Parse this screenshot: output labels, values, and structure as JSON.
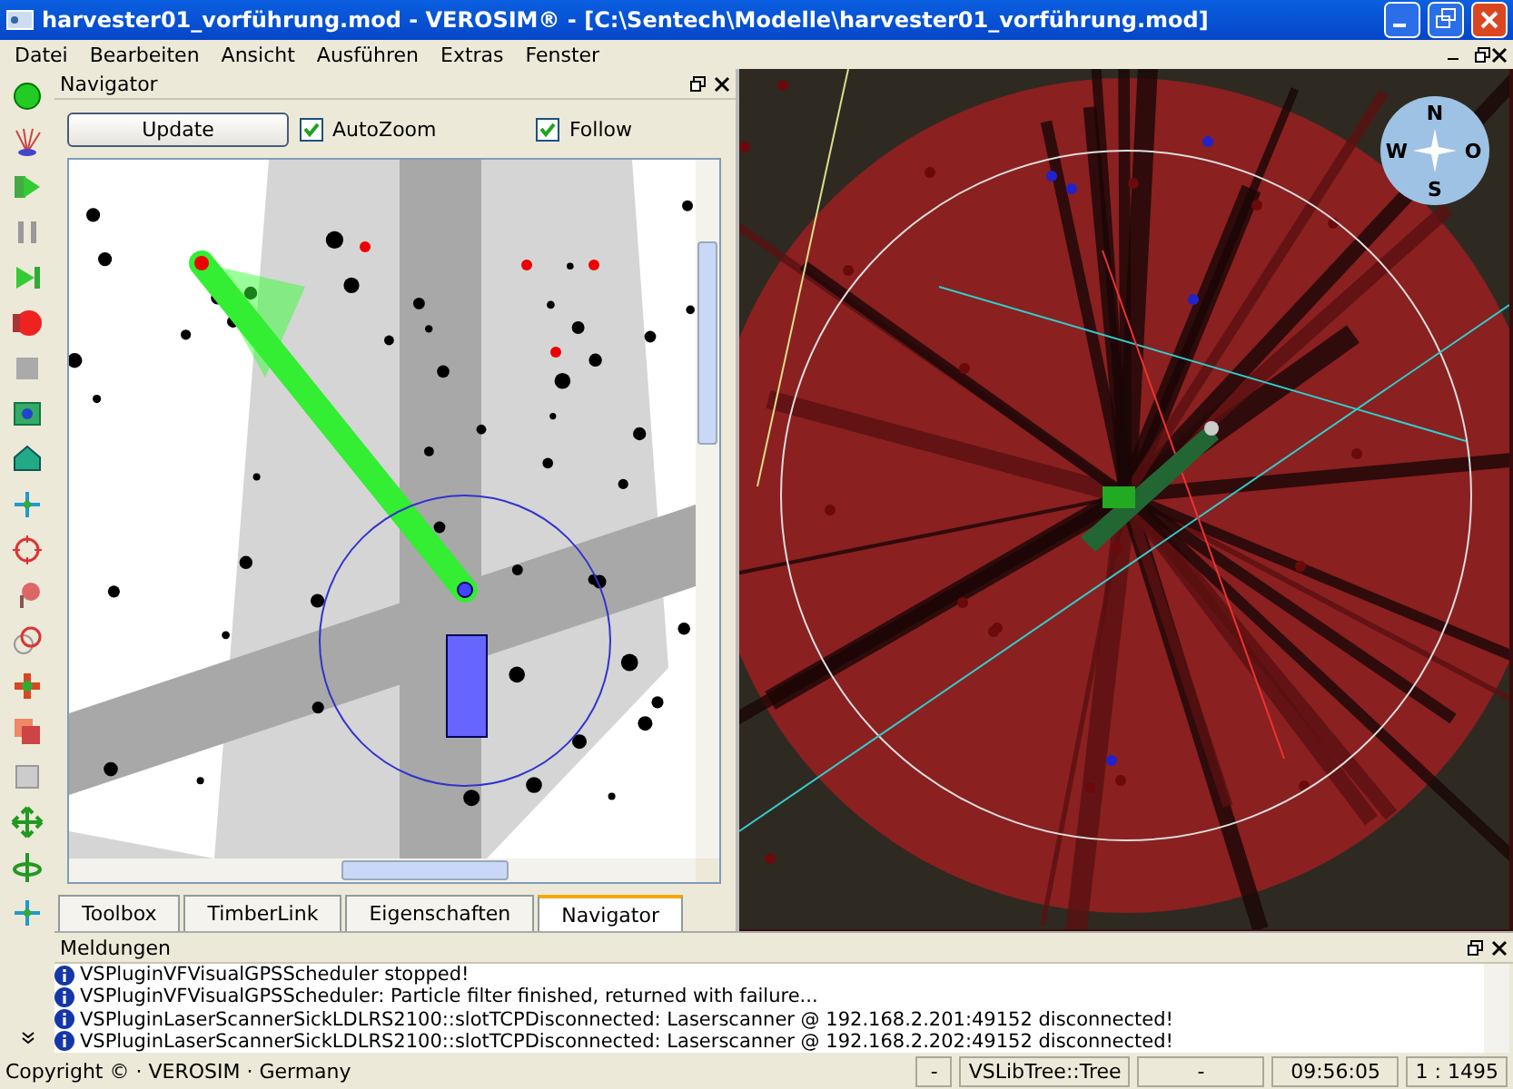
{
  "window": {
    "title": "harvester01_vorführung.mod - VEROSIM® - [C:\\Sentech\\Modelle\\harvester01_vorführung.mod]"
  },
  "menu": [
    "Datei",
    "Bearbeiten",
    "Ansicht",
    "Ausführen",
    "Extras",
    "Fenster"
  ],
  "navigator": {
    "title": "Navigator",
    "update_button": "Update",
    "options": [
      {
        "label": "AutoZoom",
        "checked": true
      },
      {
        "label": "Follow",
        "checked": true
      }
    ]
  },
  "tabs": [
    {
      "label": "Toolbox",
      "selected": false
    },
    {
      "label": "TimberLink",
      "selected": false
    },
    {
      "label": "Eigenschaften",
      "selected": false
    },
    {
      "label": "Navigator",
      "selected": true
    }
  ],
  "viewport": {
    "compass": [
      "N",
      "O",
      "S",
      "W"
    ]
  },
  "messages": {
    "title": "Meldungen",
    "items": [
      "VSPluginVFVisualGPSScheduler stopped!",
      "VSPluginVFVisualGPSScheduler: Particle filter finished, returned with failure...",
      "VSPluginLaserScannerSickLDLRS2100::slotTCPDisconnected: Laserscanner @ 192.168.2.201:49152 disconnected!",
      "VSPluginLaserScannerSickLDLRS2100::slotTCPDisconnected: Laserscanner @ 192.168.2.202:49152 disconnected!"
    ]
  },
  "status_bar": {
    "copyright": "Copyright © · VEROSIM · Germany",
    "fields": [
      "-",
      "VSLibTree::Tree",
      "-",
      "09:56:05",
      "1 : 1495"
    ]
  }
}
